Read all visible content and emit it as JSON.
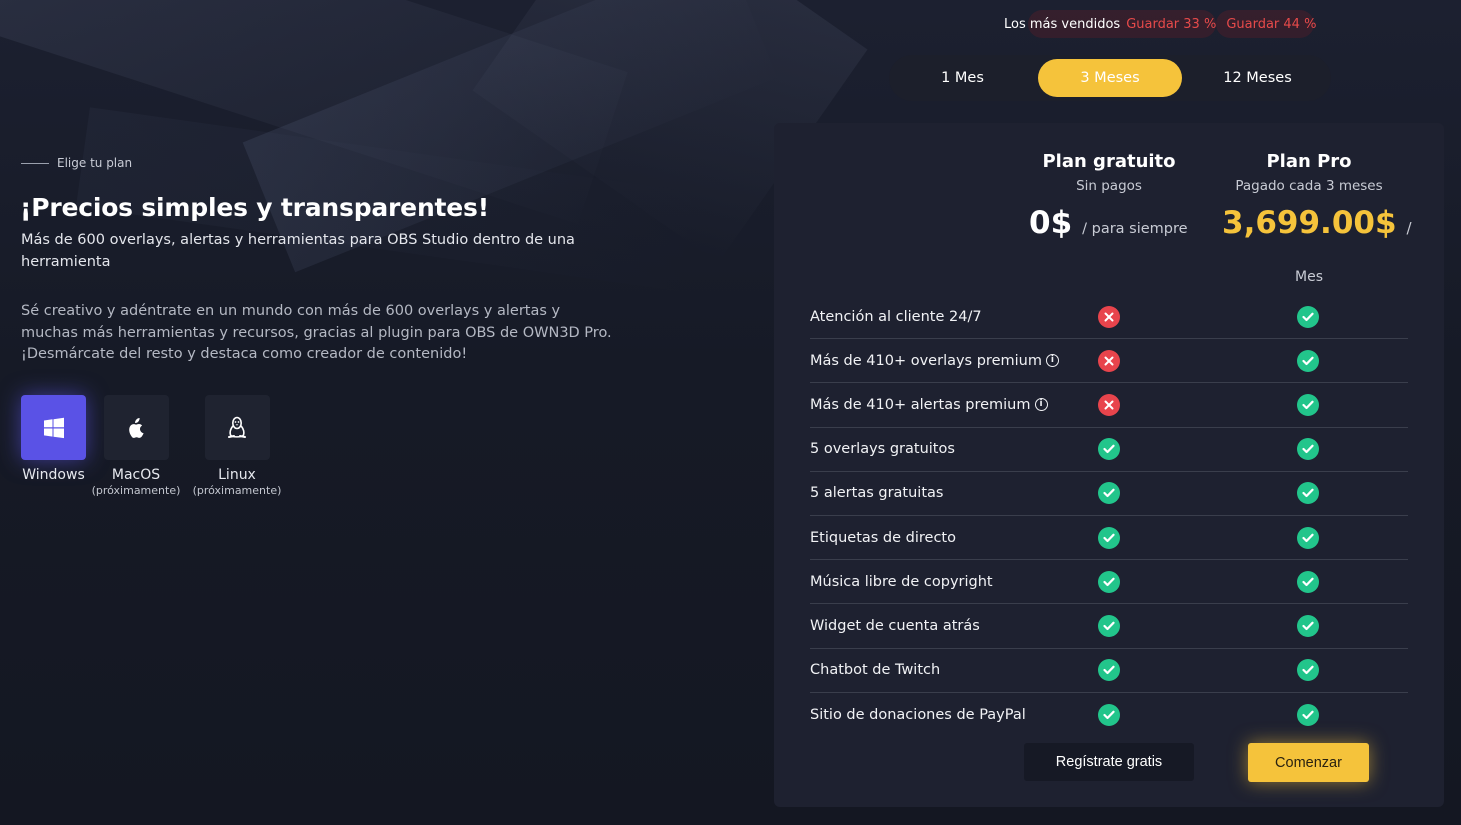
{
  "colors": {
    "accent_yellow": "#f5c33b",
    "accent_purple": "#5a52e6",
    "check_green": "#22c58b",
    "cross_red": "#e8444c",
    "savings_red": "#e64a4a",
    "card_bg": "#1e2130"
  },
  "intro": {
    "eyebrow": "Elige tu plan",
    "headline": "¡Precios simples y transparentes!",
    "subhead": "Más de 600 overlays, alertas y herramientas para OBS Studio dentro de una herramienta",
    "description": "Sé creativo y adéntrate en un mundo con más de 600 overlays y alertas y muchas más herramientas y recursos, gracias al plugin para OBS de OWN3D Pro. ¡Desmárcate del resto y destaca como creador de contenido!"
  },
  "os": [
    {
      "name": "Windows",
      "note": "",
      "icon": "windows-icon",
      "active": true
    },
    {
      "name": "MacOS",
      "note": "(próximamente)",
      "icon": "apple-icon",
      "active": false
    },
    {
      "name": "Linux",
      "note": "(próximamente)",
      "icon": "linux-icon",
      "active": false
    }
  ],
  "savings": {
    "label": "Los más vendidos",
    "save_3": "Guardar 33 %",
    "save_12": "Guardar 44 %"
  },
  "billing": {
    "options": [
      "1 Mes",
      "3 Meses",
      "12 Meses"
    ],
    "selected": "3 Meses"
  },
  "plans": {
    "free": {
      "title": "Plan gratuito",
      "subtitle": "Sin pagos",
      "price": "0$",
      "per": "/ para siempre",
      "cta": "Regístrate gratis"
    },
    "pro": {
      "title": "Plan Pro",
      "subtitle": "Pagado cada 3 meses",
      "price": "3,699.00$",
      "per": "/",
      "period": "Mes",
      "cta": "Comenzar"
    }
  },
  "features": [
    {
      "name": "Atención al cliente 24/7",
      "info": false,
      "free": false,
      "pro": true
    },
    {
      "name": "Más de 410+ overlays premium",
      "info": true,
      "free": false,
      "pro": true
    },
    {
      "name": "Más de 410+ alertas premium",
      "info": true,
      "free": false,
      "pro": true
    },
    {
      "name": "5 overlays gratuitos",
      "info": false,
      "free": true,
      "pro": true
    },
    {
      "name": "5 alertas gratuitas",
      "info": false,
      "free": true,
      "pro": true
    },
    {
      "name": "Etiquetas de directo",
      "info": false,
      "free": true,
      "pro": true
    },
    {
      "name": "Música libre de copyright",
      "info": false,
      "free": true,
      "pro": true
    },
    {
      "name": "Widget de cuenta atrás",
      "info": false,
      "free": true,
      "pro": true
    },
    {
      "name": "Chatbot de Twitch",
      "info": false,
      "free": true,
      "pro": true
    },
    {
      "name": "Sitio de donaciones de PayPal",
      "info": false,
      "free": true,
      "pro": true
    }
  ]
}
